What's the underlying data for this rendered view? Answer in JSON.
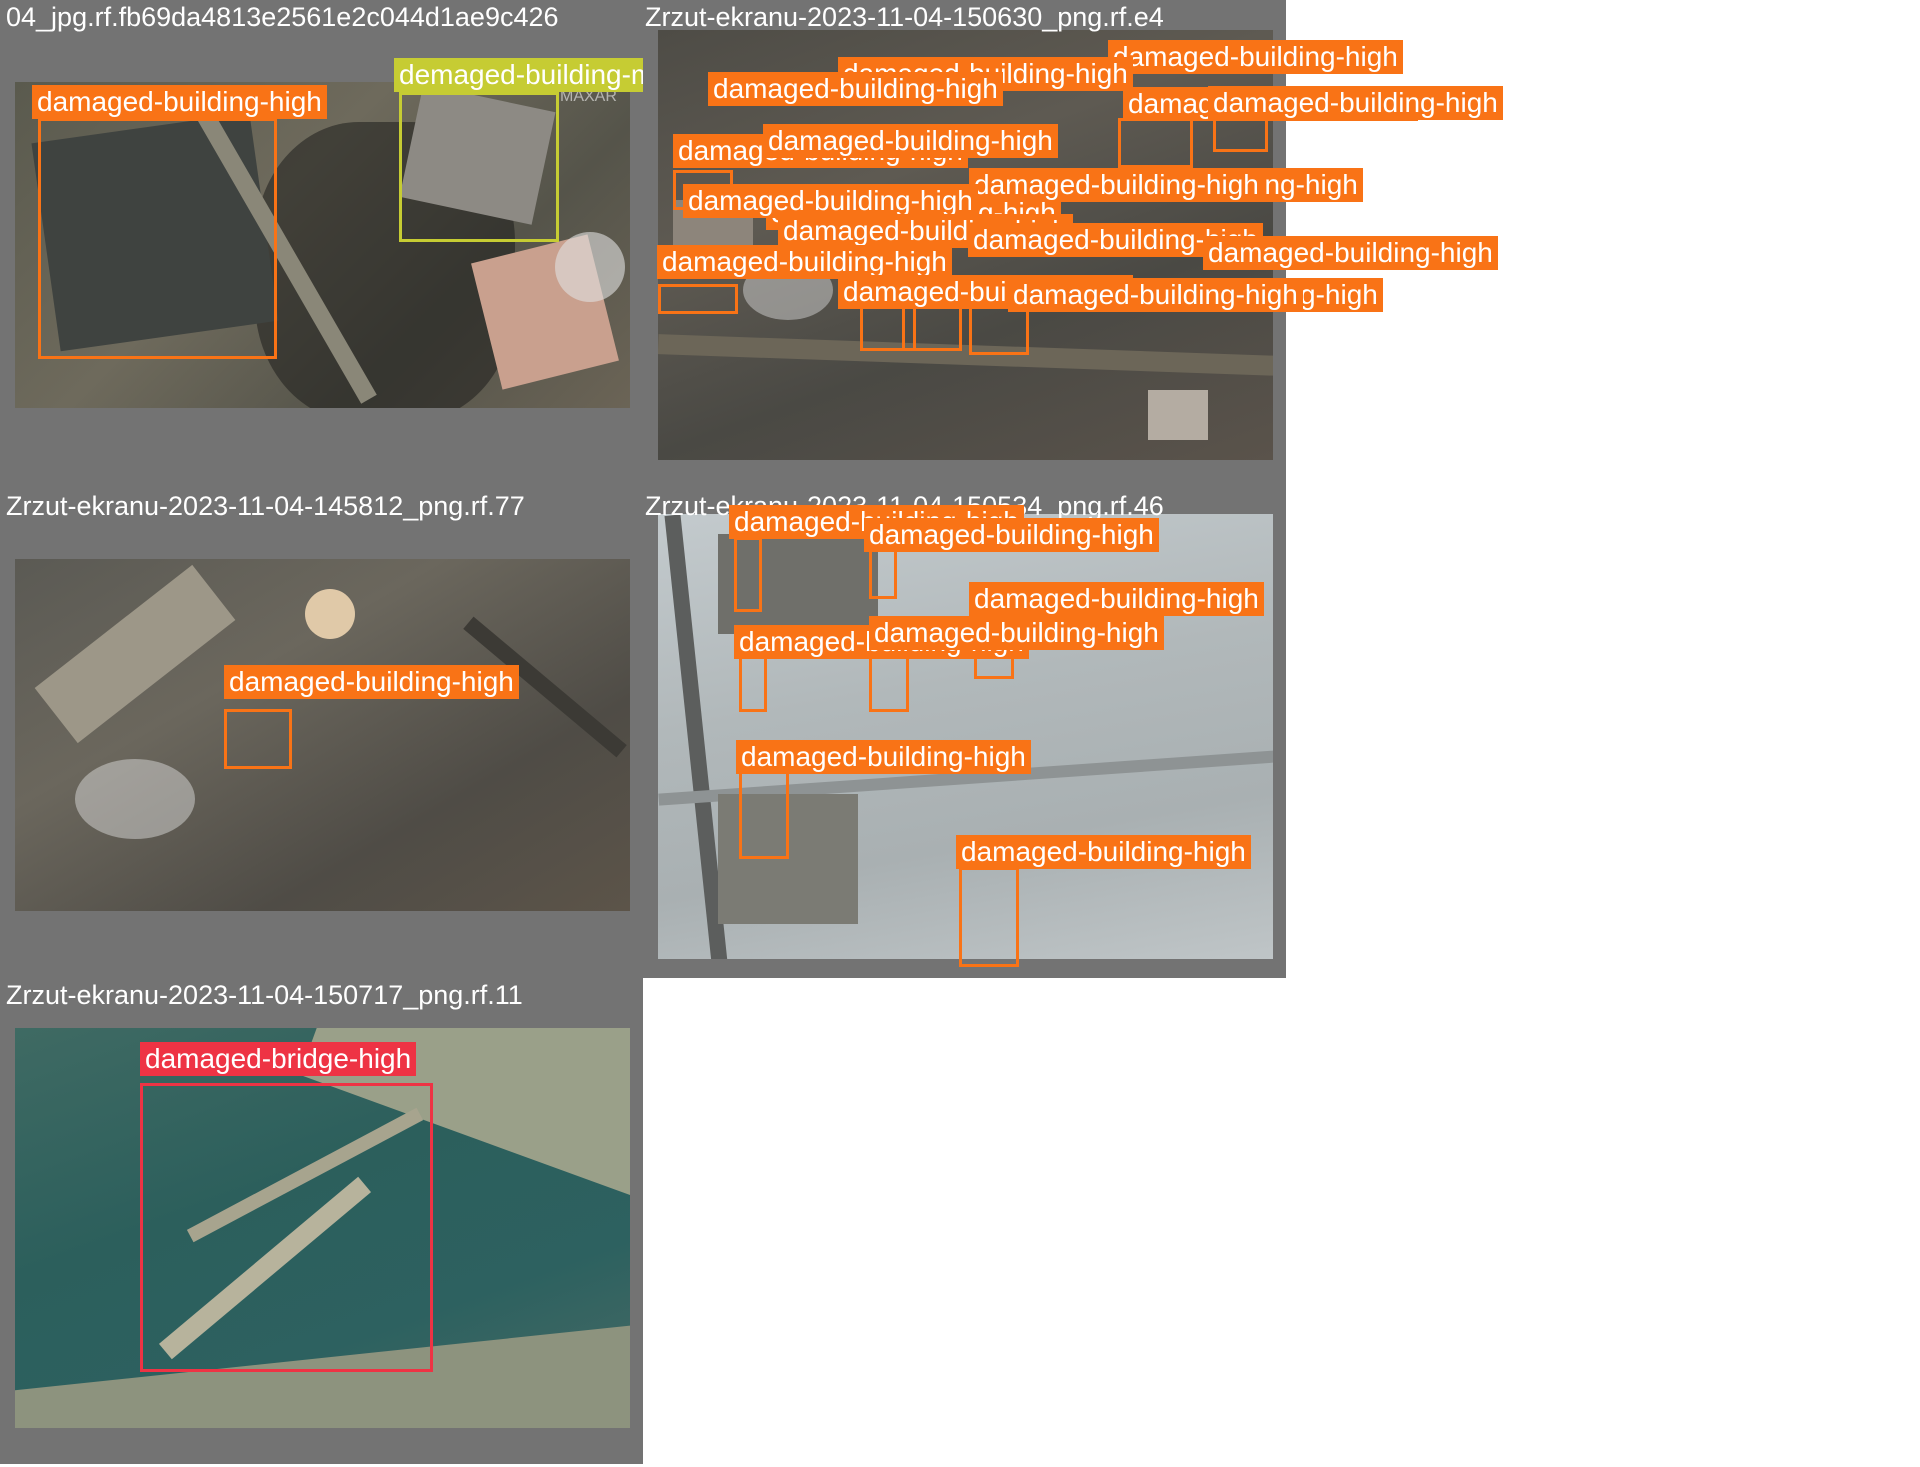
{
  "colors": {
    "high": "#f97316",
    "medium": "#c6cc33",
    "bridge": "#ee3344",
    "tile_bg": "#737373"
  },
  "tiles": [
    {
      "title": "04_jpg.rf.fb69da4813e2561e2c044d1ae9c426",
      "watermark": "MAXAR",
      "labels": [
        "damaged-building-high",
        "demaged-building-medium"
      ]
    },
    {
      "title": "Zrzut-ekranu-2023-11-04-150630_png.rf.e4",
      "labels": [
        "damaged-building-high",
        "damaged-building-high",
        "damaged-building-high",
        "damaged-building-high",
        "damaged-building-high",
        "damaged-building-high",
        "damaged-building-high",
        "damaged-building-high",
        "damaged-building-high",
        "damaged-building-high",
        "damaged-building-high",
        "damaged-building-high",
        "damaged-building-high",
        "damaged-building-high",
        "damaged-building-high",
        "damaged-building-high",
        "damaged-building-high",
        "damaged-building-high"
      ]
    },
    {
      "title": "Zrzut-ekranu-2023-11-04-145812_png.rf.77",
      "labels": [
        "damaged-building-high"
      ]
    },
    {
      "title": "Zrzut-ekranu-2023-11-04-150534_png.rf.46",
      "labels": [
        "damaged-building-high",
        "damaged-building-high",
        "damaged-building-high",
        "damaged-building-high",
        "damaged-building-high",
        "damaged-building-high",
        "damaged-building-high"
      ]
    },
    {
      "title": "Zrzut-ekranu-2023-11-04-150717_png.rf.11",
      "labels": [
        "damaged-bridge-high"
      ]
    }
  ]
}
